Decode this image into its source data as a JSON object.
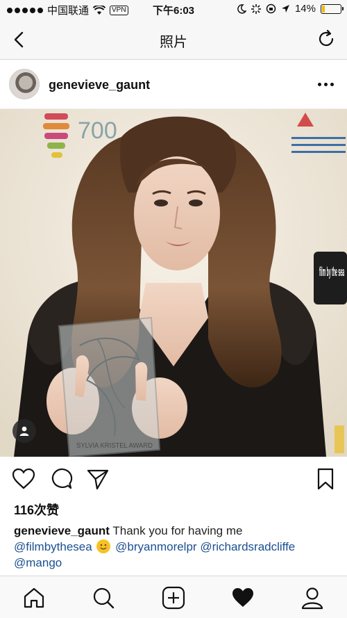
{
  "status_bar": {
    "carrier": "中国联通",
    "wifi_icon": "wifi-icon",
    "vpn": "VPN",
    "time": "下午6:03",
    "battery": "14%",
    "battery_level": 0.14,
    "battery_color": "#f5b800"
  },
  "navbar": {
    "title": "照片",
    "back_icon": "chevron-left-icon",
    "refresh_icon": "refresh-icon"
  },
  "post": {
    "username": "genevieve_gaunt",
    "avatar": "avatar",
    "more_icon": "more-options-icon",
    "likes": "116次赞",
    "caption": {
      "username": "genevieve_gaunt",
      "text": "Thank you for having me",
      "mentions": [
        "@filmbythesea",
        "@bryanmorelpr",
        "@richardsradcliffe",
        "@mango"
      ]
    },
    "photo_texts": {
      "award_text": "SYLVIA KRISTEL AWARD",
      "backdrop_logo": "film by the sea",
      "backdrop_number": "700"
    }
  },
  "actions": {
    "like_icon": "heart-icon",
    "comment_icon": "comment-icon",
    "share_icon": "send-icon",
    "save_icon": "bookmark-icon"
  },
  "tabbar": {
    "items": [
      "home-icon",
      "search-icon",
      "add-icon",
      "activity-heart-icon",
      "profile-icon"
    ]
  },
  "colors": {
    "mention": "#1b4f91",
    "bar_background": "#f7f7f7"
  }
}
